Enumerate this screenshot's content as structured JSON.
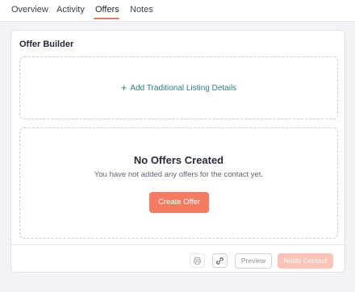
{
  "tabs": [
    {
      "label": "Overview",
      "active": false
    },
    {
      "label": "Activity",
      "active": false
    },
    {
      "label": "Offers",
      "active": true
    },
    {
      "label": "Notes",
      "active": false
    }
  ],
  "panel": {
    "title": "Offer Builder",
    "add_link": "Add Traditional Listing Details",
    "empty_title": "No Offers Created",
    "empty_subtitle": "You have not added any offers for the contact yet.",
    "create_button": "Create Offer"
  },
  "footer": {
    "print_icon": "printer-icon",
    "link_icon": "link-icon",
    "preview_label": "Preview",
    "notify_label": "Notify Contact"
  },
  "colors": {
    "accent": "#f47a62",
    "accent_disabled": "#fbc3b7",
    "link": "#2f7d84",
    "background": "#f1f3f6"
  }
}
